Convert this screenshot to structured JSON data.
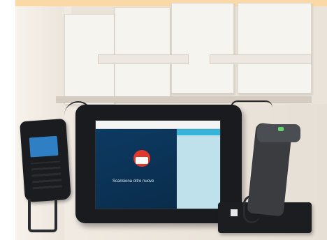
{
  "photo": {
    "screen_caption": "Scansiona oltre nuove"
  },
  "colors": {
    "banner": "#fbd9a6",
    "screen_left": "#0c3a63",
    "screen_right": "#bfe1ec",
    "logo": "#e0392c",
    "reader_screen": "#2f7fc4"
  }
}
